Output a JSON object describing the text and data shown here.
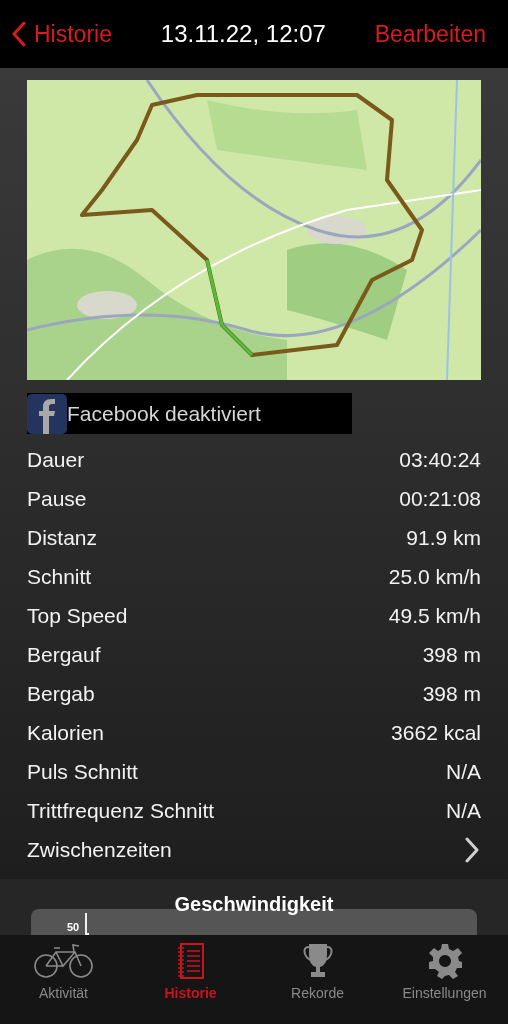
{
  "nav": {
    "back": "Historie",
    "title": "13.11.22, 12:07",
    "action": "Bearbeiten"
  },
  "facebook": {
    "label": "Facebook deaktiviert"
  },
  "stats": [
    {
      "label": "Dauer",
      "value": "03:40:24",
      "kind": "value"
    },
    {
      "label": "Pause",
      "value": "00:21:08",
      "kind": "value"
    },
    {
      "label": "Distanz",
      "value": "91.9 km",
      "kind": "value"
    },
    {
      "label": "Schnitt",
      "value": "25.0 km/h",
      "kind": "value"
    },
    {
      "label": "Top Speed",
      "value": "49.5 km/h",
      "kind": "value"
    },
    {
      "label": "Bergauf",
      "value": "398 m",
      "kind": "value"
    },
    {
      "label": "Bergab",
      "value": "398 m",
      "kind": "value"
    },
    {
      "label": "Kalorien",
      "value": "3662 kcal",
      "kind": "value"
    },
    {
      "label": "Puls Schnitt",
      "value": "N/A",
      "kind": "value"
    },
    {
      "label": "Trittfrequenz Schnitt",
      "value": "N/A",
      "kind": "value"
    },
    {
      "label": "Zwischenzeiten",
      "kind": "link"
    }
  ],
  "speed_chart": {
    "title": "Geschwindigkeit",
    "axis_label": "50"
  },
  "tab_bar": [
    {
      "label": "Aktivität",
      "selected": false
    },
    {
      "label": "Historie",
      "selected": true
    },
    {
      "label": "Rekorde",
      "selected": false
    },
    {
      "label": "Einstellungen",
      "selected": false
    }
  ]
}
